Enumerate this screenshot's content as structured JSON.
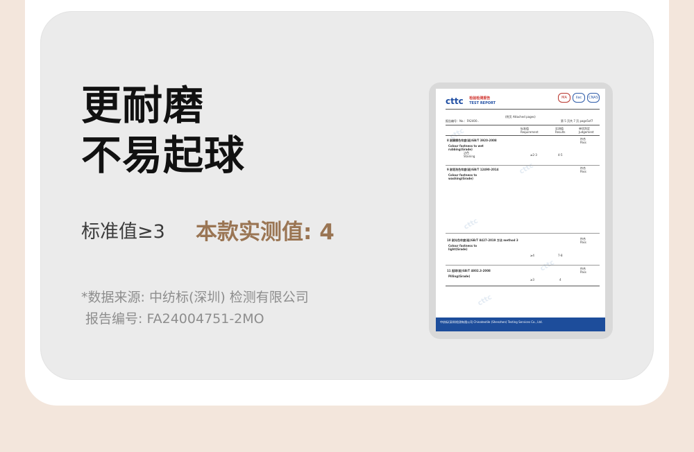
{
  "headline": {
    "line1": "更耐磨",
    "line2": "不易起球"
  },
  "standard": {
    "label": "标准值≥3"
  },
  "measured": {
    "label": "本款实测值: 4"
  },
  "source": {
    "line1": "*数据来源: 中纺标(深圳) 检测有限公司",
    "line2": "报告编号: FA24004751-2MO"
  },
  "report": {
    "logo_text": "cttc",
    "logo_sub_cn": "检验检测报告",
    "logo_sub_en": "TEST REPORT",
    "mark1": "MA",
    "mark2": "ilac",
    "mark3": "CNAS",
    "attached": "(附页 Attached pages)",
    "report_no": "报告编号：No.：FA2400..",
    "page": "第 5 页共 7 页 page5of7",
    "col_requirement": "标准值 Requirement",
    "col_results": "实测值 Results",
    "col_judgement": "单项判定 Judgement",
    "s1_title": "8 耐摩擦色牢度(级)GB/T 3920-2008",
    "s1_item": "Colour fastness to wet rubbing(Grade)",
    "s1_sub": "沾色 Staining",
    "s1_req": "≥2-3",
    "s1_res": "4-5",
    "s1_judge": "符合 Pass",
    "s2_title": "9 耐皂洗色牢度(级)GB/T 12490-2014",
    "s2_item": "Colour fastness to washing(Grade)",
    "s2_judge": "符合 Pass",
    "s3_title": "10 耐光色牢度(级)GB/T 8427-2019 方法 method 3",
    "s3_item": "Colour fastness to light(Grade)",
    "s3_req": "≥4",
    "s3_res": "7-8",
    "s3_judge": "符合 Pass",
    "s4_title": "11 起球(级)GB/T 4802.3-2008",
    "s4_item": "Pilling(Grade)",
    "s4_req": "≥3",
    "s4_res": "4",
    "s4_judge": "符合 Pass",
    "footer": "中纺标(深圳)检测有限公司 Chinatextile (Shenzhen) Testing Services Co., Ltd."
  }
}
